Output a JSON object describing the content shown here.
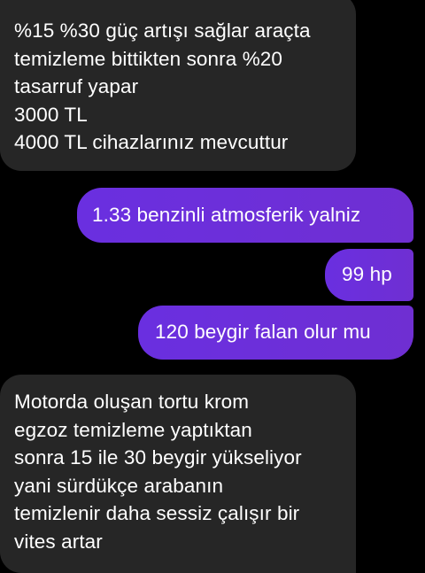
{
  "conversation": {
    "messages": [
      {
        "direction": "incoming",
        "text": "%15 %30 güç artışı sağlar araçta\ntemizleme bittikten sonra %20\ntasarruf yapar\n3000 TL\n4000 TL cihazlarınız mevcuttur"
      },
      {
        "direction": "outgoing",
        "text": "1.33 benzinli atmosferik yalniz"
      },
      {
        "direction": "outgoing",
        "text": "99 hp"
      },
      {
        "direction": "outgoing",
        "text": "120 beygir falan olur mu"
      },
      {
        "direction": "incoming",
        "text": "Motorda oluşan tortu krom\negzoz temizleme yaptıktan\nsonra 15 ile 30 beygir yükseliyor\nyani sürdükçe arabanın\ntemizlenir daha sessiz çalışır bir\nvites artar"
      }
    ]
  },
  "colors": {
    "background": "#000000",
    "incoming_bubble": "#262626",
    "outgoing_bubble": "#6b2fd9",
    "text": "#ffffff"
  }
}
